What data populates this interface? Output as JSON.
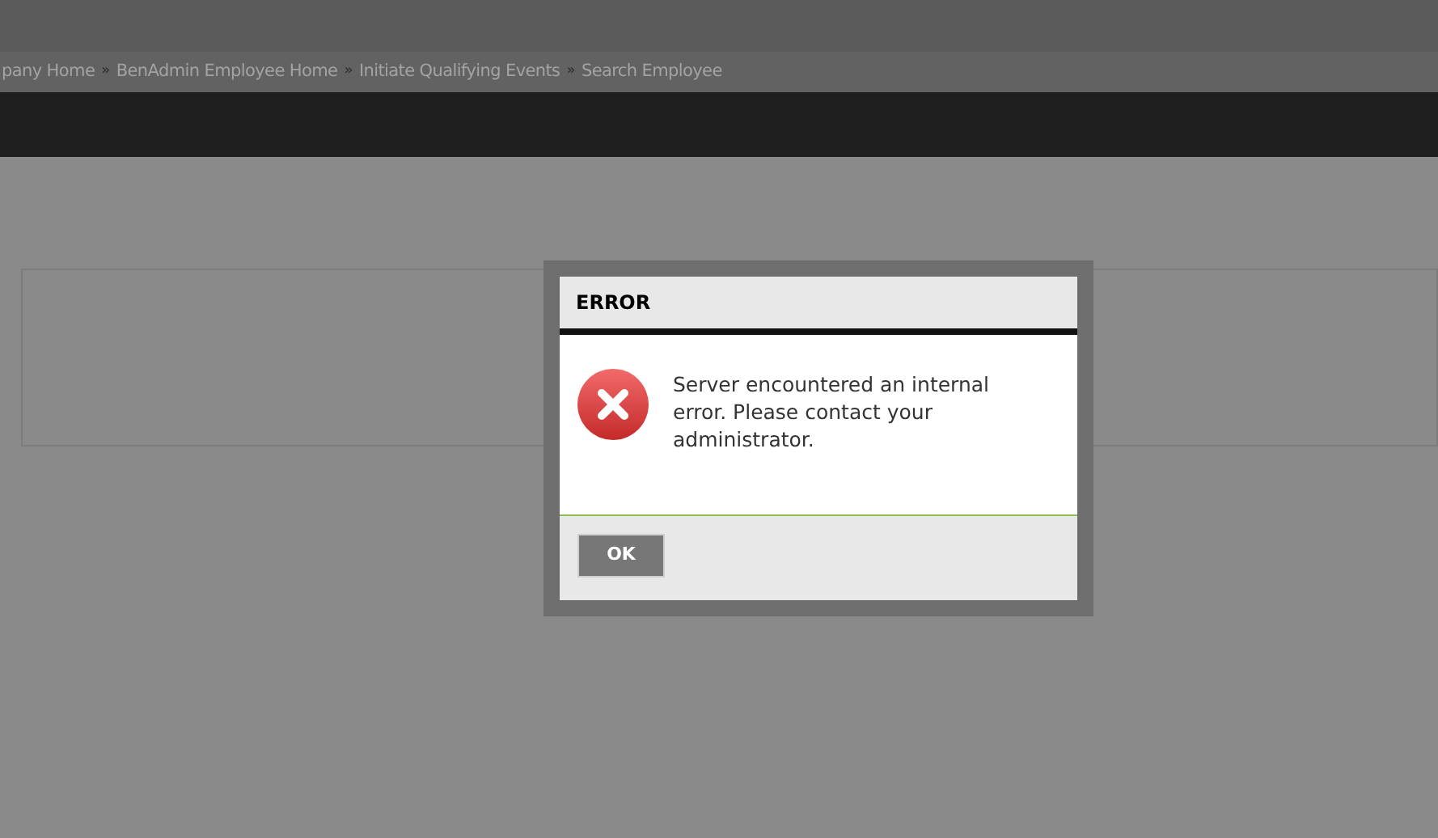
{
  "breadcrumb": [
    {
      "label": "pany Home",
      "separator": "»"
    },
    {
      "label": "BenAdmin Employee Home",
      "separator": "»"
    },
    {
      "label": "Initiate Qualifying Events",
      "separator": "»"
    },
    {
      "label": "Search Employee"
    }
  ],
  "dialog": {
    "title": "ERROR",
    "message": "Server encountered an internal error. Please contact your administrator.",
    "buttons": [
      "OK"
    ]
  }
}
